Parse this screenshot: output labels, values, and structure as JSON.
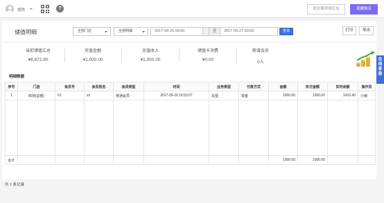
{
  "topbar": {
    "user": "悠然",
    "feedback_btn": "提交案例得红包",
    "buy_btn": "我要购买"
  },
  "toolbar": {
    "title": "储值明细",
    "store_select": "全部门店",
    "detail_select": "全部明细",
    "date_from": "2017-09-26 00:00",
    "to_label": "至",
    "date_to": "2017-09-27 00:00",
    "query_btn": "查询",
    "print_btn": "打印",
    "export_btn": "导出"
  },
  "summary": [
    {
      "label": "当前储值汇总",
      "value": "¥6,872.80"
    },
    {
      "label": "充值金额",
      "value": "¥1,000.00"
    },
    {
      "label": "充值收入",
      "value": "¥1,000.00"
    },
    {
      "label": "储值卡消费",
      "value": "¥0.00"
    },
    {
      "label": "新增会员",
      "value": "0人"
    }
  ],
  "section_title": "明细数据",
  "table": {
    "headers": [
      "序号",
      "门店",
      "会员号",
      "会员姓名",
      "会员类型",
      "时间",
      "业务类型",
      "付款方式",
      "金额",
      "实付金额",
      "实时余额",
      "操作员"
    ],
    "row": [
      "1",
      "悼测(总部)",
      "01",
      "zx",
      "普通会员",
      "2017-09-26 16:52:07",
      "充值",
      "现金",
      "1000.00",
      "1000.00",
      "1410.40",
      "小雨"
    ],
    "total_label": "合计",
    "total_amount": "1000.00",
    "total_paid": "1000.00"
  },
  "side_tab": [
    "在",
    "线",
    "客",
    "服"
  ],
  "record_count": "共 1 条记录",
  "colors": {
    "accent_blue": "#3d6fd9",
    "buy_purple": "#7a6cf0"
  },
  "icons": [
    "avatar",
    "qr-code-icon",
    "help-icon",
    "calendar-icon",
    "growth-chart-icon"
  ]
}
